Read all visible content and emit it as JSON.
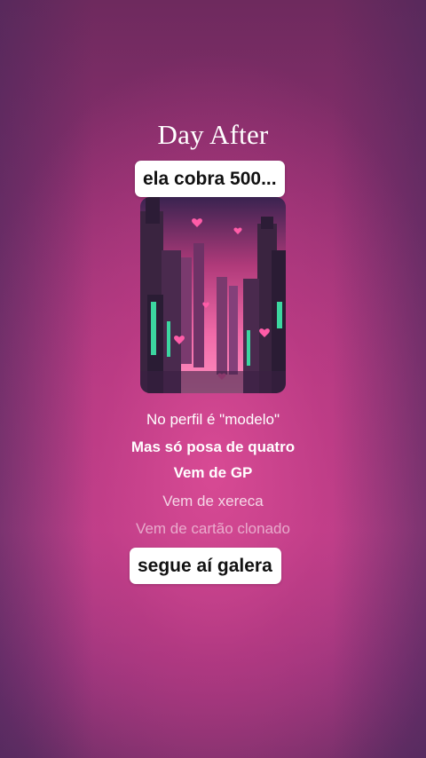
{
  "song": {
    "title": "Day After",
    "cover_icon": "album-cover-city-hearts"
  },
  "stickers": {
    "top": "ela cobra 500...",
    "bottom": "segue aí galera"
  },
  "lyrics": [
    "No perfil é \"modelo\"",
    "Mas só posa de quatro",
    "Vem de GP",
    "Vem de xereca",
    "Vem de cartão clonado"
  ],
  "colors": {
    "background": "#a83a80",
    "highlight": "#d84a94",
    "text": "#ffffff",
    "sticker_bg": "#ffffff"
  }
}
